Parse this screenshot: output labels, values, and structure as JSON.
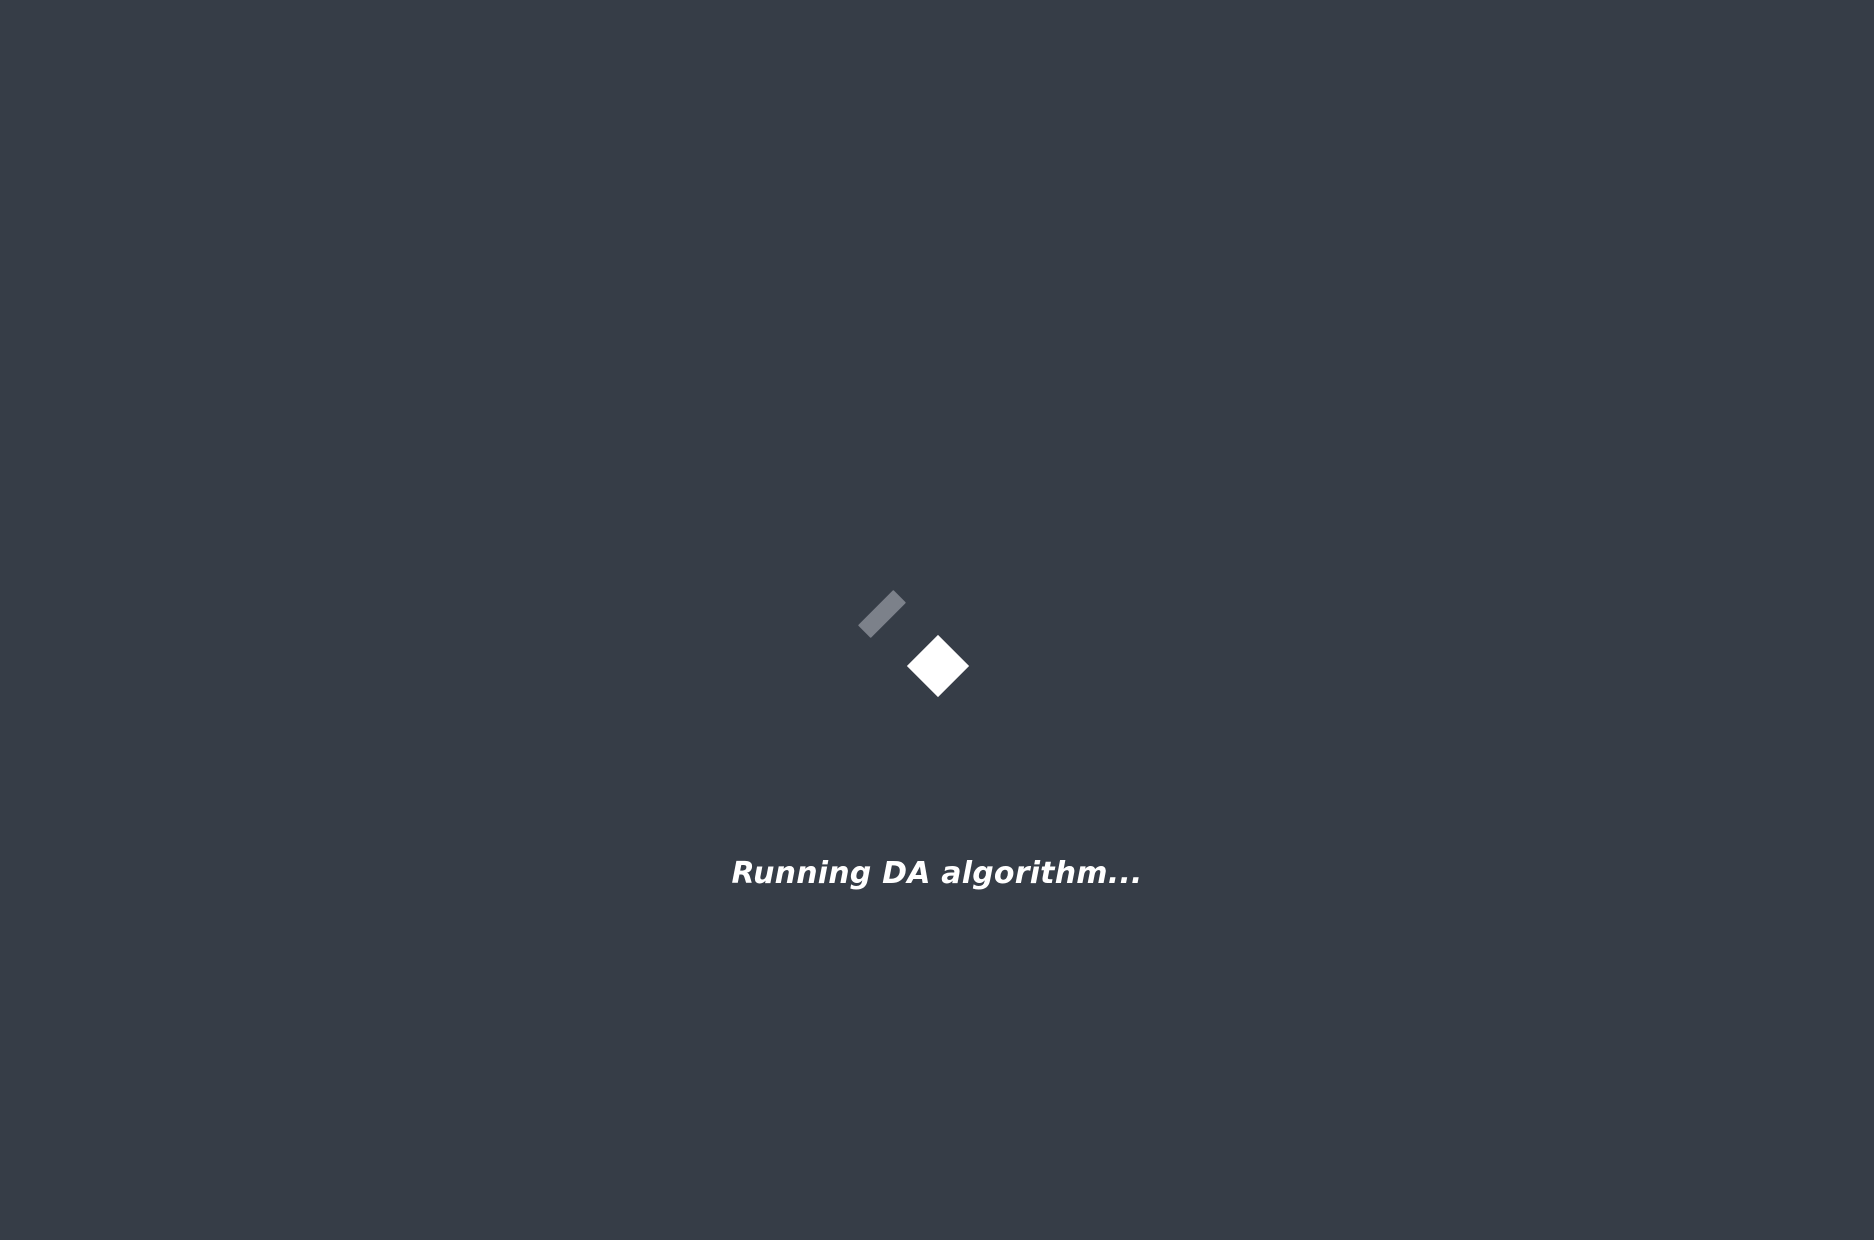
{
  "overlay": {
    "background": "#363d47",
    "message": "Running DA algorithm...",
    "spinner": {
      "primary_color": "#ffffff",
      "ghost_color": "#7c818a"
    }
  }
}
